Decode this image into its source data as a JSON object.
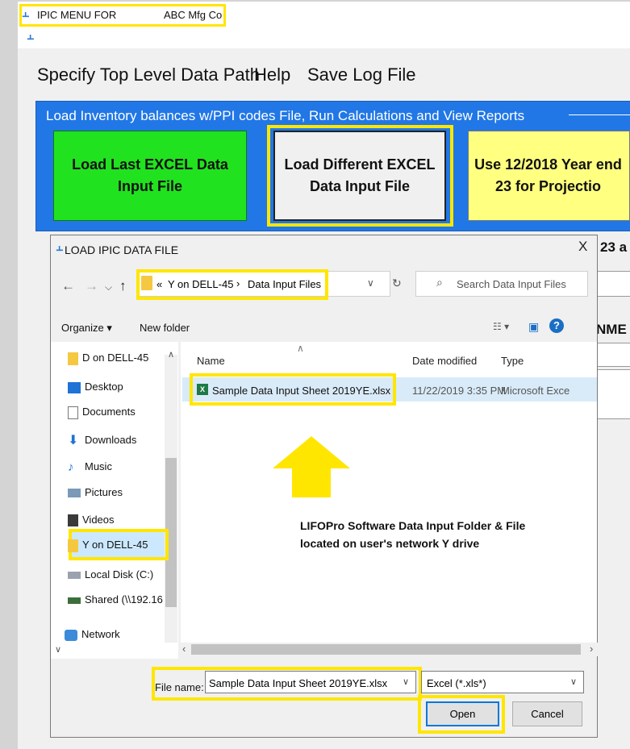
{
  "app": {
    "title_label": "IPIC MENU FOR",
    "company": "ABC Mfg Co"
  },
  "menu": {
    "items": [
      "Specify Top Level Data Path",
      "Help",
      "Save Log File"
    ]
  },
  "group": {
    "label": "Load Inventory balances w/PPI codes File, Run Calculations and View Reports",
    "buttons": [
      {
        "label": "Load Last EXCEL Data Input File",
        "color": "#21e21f"
      },
      {
        "label": "Load Different EXCEL Data Input File",
        "color": "#f0f0f0"
      },
      {
        "label": "Use 12/2018 Year end 23 for Projectio",
        "color": "#ffff80"
      }
    ]
  },
  "right_panel": {
    "text1": "23 a",
    "text2": "NME"
  },
  "dialog": {
    "title": "LOAD IPIC DATA FILE",
    "close": "X",
    "address": {
      "prefix": "«",
      "part1": "Y on DELL-45",
      "sep": "›",
      "part2": "Data Input Files"
    },
    "search_placeholder": "Search Data Input Files",
    "toolbar": {
      "organize": "Organize ▾",
      "new_folder": "New folder"
    },
    "nav_items": [
      {
        "label": "D on DELL-45",
        "icon": "folder-icon"
      },
      {
        "label": "Desktop",
        "icon": "desktop-icon"
      },
      {
        "label": "Documents",
        "icon": "documents-icon"
      },
      {
        "label": "Downloads",
        "icon": "downloads-icon"
      },
      {
        "label": "Music",
        "icon": "music-icon"
      },
      {
        "label": "Pictures",
        "icon": "pictures-icon"
      },
      {
        "label": "Videos",
        "icon": "videos-icon"
      },
      {
        "label": "Y on DELL-45",
        "icon": "folder-icon",
        "selected": true
      },
      {
        "label": "Local Disk (C:)",
        "icon": "drive-icon"
      },
      {
        "label": "Shared (\\\\192.16",
        "icon": "network-drive-icon"
      },
      {
        "label": "Network",
        "icon": "network-icon"
      }
    ],
    "columns": {
      "name": "Name",
      "date": "Date modified",
      "type": "Type"
    },
    "file": {
      "name": "Sample Data Input Sheet 2019YE.xlsx",
      "date": "11/22/2019 3:35 PM",
      "type": "Microsoft Exce"
    },
    "annotation_line1": "LIFOPro Software Data Input Folder & File",
    "annotation_line2": "located on user's network Y drive",
    "file_name_label": "File name:",
    "file_name_value": "Sample Data Input Sheet 2019YE.xlsx",
    "file_type": "Excel (*.xls*)",
    "open_label": "Open",
    "cancel_label": "Cancel"
  },
  "colors": {
    "highlight": "#ffe600",
    "group_blue": "#2177e6",
    "accent": "#0078d7"
  }
}
